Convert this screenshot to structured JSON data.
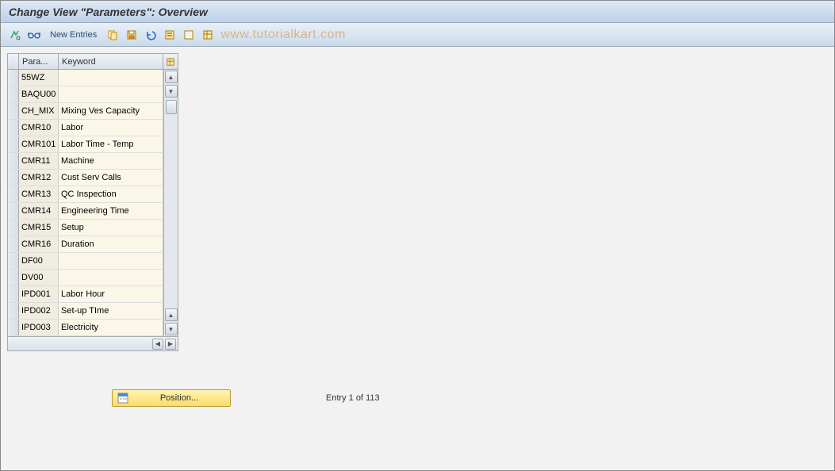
{
  "title": "Change View \"Parameters\": Overview",
  "toolbar": {
    "new_entries": "New Entries"
  },
  "watermark": "www.tutorialkart.com",
  "table": {
    "headers": {
      "para": "Para...",
      "keyword": "Keyword"
    },
    "rows": [
      {
        "para": "55WZ",
        "key": ""
      },
      {
        "para": "BAQU00",
        "key": ""
      },
      {
        "para": "CH_MIX",
        "key": "Mixing Ves Capacity"
      },
      {
        "para": "CMR10",
        "key": "Labor"
      },
      {
        "para": "CMR101",
        "key": "Labor Time - Temp"
      },
      {
        "para": "CMR11",
        "key": "Machine"
      },
      {
        "para": "CMR12",
        "key": "Cust Serv Calls"
      },
      {
        "para": "CMR13",
        "key": "QC Inspection"
      },
      {
        "para": "CMR14",
        "key": "Engineering Time"
      },
      {
        "para": "CMR15",
        "key": "Setup"
      },
      {
        "para": "CMR16",
        "key": "Duration"
      },
      {
        "para": "DF00",
        "key": ""
      },
      {
        "para": "DV00",
        "key": ""
      },
      {
        "para": "IPD001",
        "key": "Labor Hour"
      },
      {
        "para": "IPD002",
        "key": "Set-up TIme"
      },
      {
        "para": "IPD003",
        "key": "Electricity"
      }
    ]
  },
  "position_button": "Position...",
  "entry_status": "Entry 1 of 113"
}
